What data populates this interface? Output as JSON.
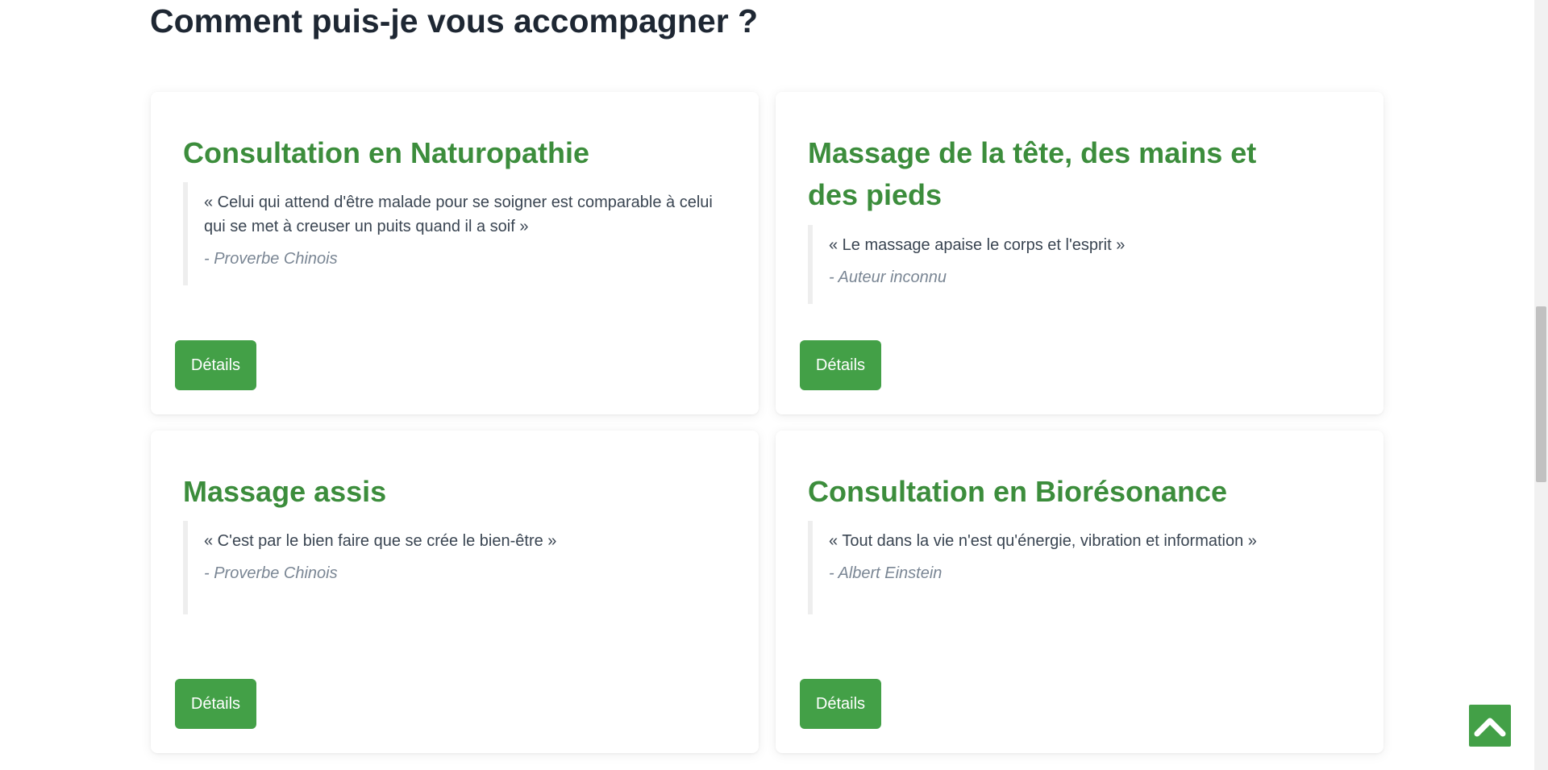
{
  "section": {
    "title": "Comment puis-je vous accompagner ?"
  },
  "cards": [
    {
      "title": "Consultation en Naturopathie",
      "quote": "« Celui qui attend d'être malade pour se soigner est comparable à celui qui se met à creuser un puits quand il a soif »",
      "author": "- Proverbe Chinois",
      "button_label": "Détails"
    },
    {
      "title": "Massage de la tête, des mains et des pieds",
      "quote": "« Le massage apaise le corps et l'esprit »",
      "author": "- Auteur inconnu",
      "button_label": "Détails"
    },
    {
      "title": "Massage assis",
      "quote": "« C'est par le bien faire que se crée le bien-être »",
      "author": "- Proverbe Chinois",
      "button_label": "Détails"
    },
    {
      "title": "Consultation en Biorésonance",
      "quote": "« Tout dans la vie n'est qu'énergie, vibration et information »",
      "author": "- Albert Einstein",
      "button_label": "Détails"
    }
  ],
  "scroll_top": {
    "icon": "chevron-up-icon"
  },
  "colors": {
    "accent_green": "#43a047",
    "title_green": "#3c8d3c",
    "heading_dark": "#1e2733"
  }
}
